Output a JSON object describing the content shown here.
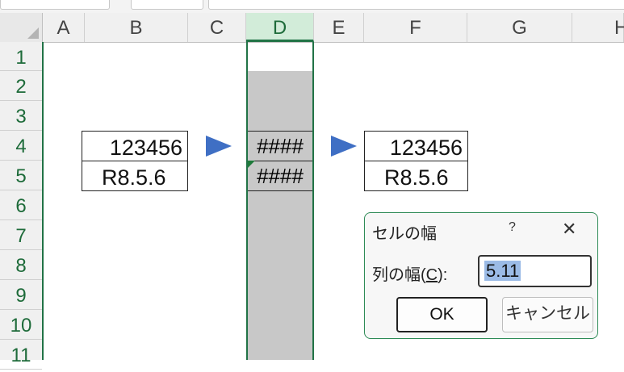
{
  "sheet": {
    "columns": [
      "A",
      "B",
      "C",
      "D",
      "E",
      "F",
      "G",
      "H"
    ],
    "selected_column": "D",
    "rows": [
      "1",
      "2",
      "3",
      "4",
      "5",
      "6",
      "7",
      "8",
      "9",
      "10",
      "11"
    ]
  },
  "cells": {
    "B4": "123456",
    "B5": "R8.5.6",
    "D4": "####",
    "D5": "####",
    "F4": "123456",
    "F5": "R8.5.6"
  },
  "dialog": {
    "title": "セルの幅",
    "help": "?",
    "close": "✕",
    "label_prefix": "列の幅(",
    "label_key": "C",
    "label_suffix": "):",
    "value": "5.11",
    "ok": "OK",
    "cancel": "キャンセル"
  },
  "colors": {
    "accent": "#217346",
    "arrow": "#3f6fc4",
    "selection": "#c8c8c8"
  }
}
